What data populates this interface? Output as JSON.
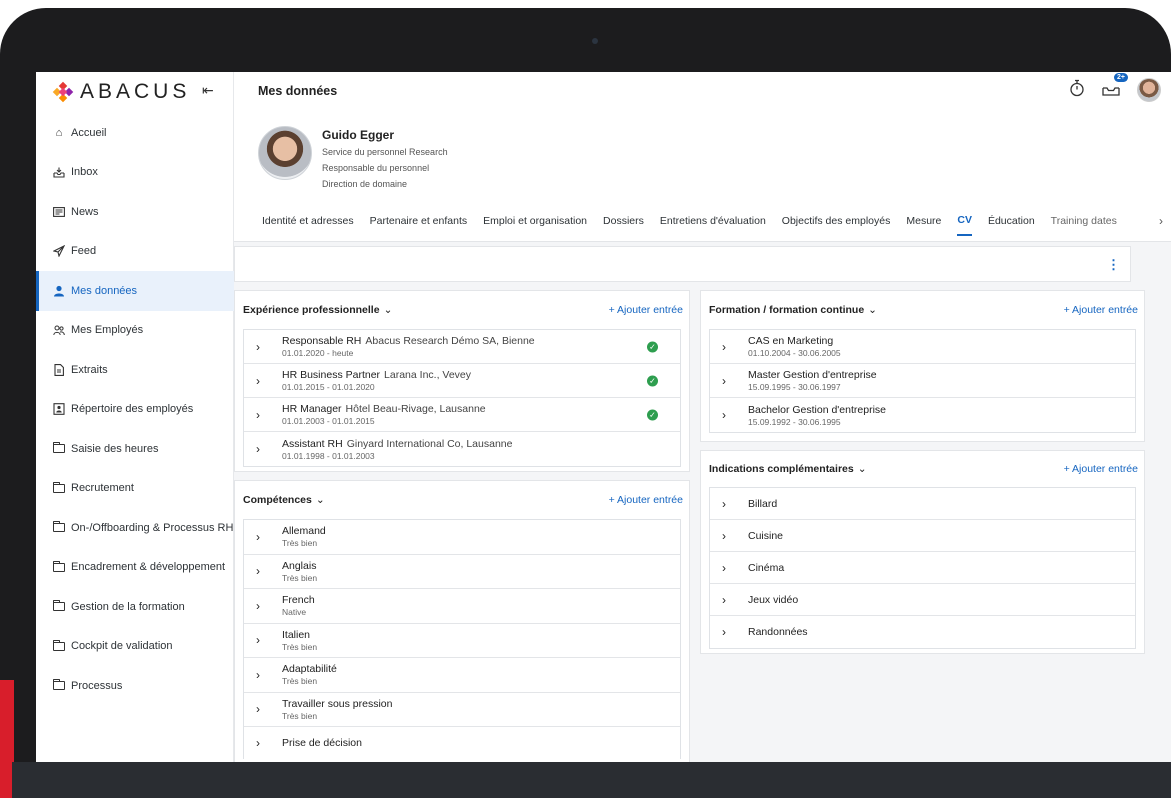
{
  "app": {
    "logo_text": "ABACUS",
    "logo_icon": "abacus-diamond-logo",
    "accent": "#1565c0"
  },
  "sidebar": {
    "collapse_icon": "collapse-left-icon",
    "items": [
      {
        "label": "Accueil",
        "icon": "home-icon"
      },
      {
        "label": "Inbox",
        "icon": "inbox-icon"
      },
      {
        "label": "News",
        "icon": "news-icon"
      },
      {
        "label": "Feed",
        "icon": "feed-icon"
      },
      {
        "label": "Mes données",
        "icon": "person-icon",
        "active": true
      },
      {
        "label": "Mes Employés",
        "icon": "people-icon"
      },
      {
        "label": "Extraits",
        "icon": "document-icon"
      },
      {
        "label": "Répertoire des employés",
        "icon": "directory-icon"
      },
      {
        "label": "Saisie des heures",
        "icon": "folder-icon"
      },
      {
        "label": "Recrutement",
        "icon": "folder-icon"
      },
      {
        "label": "On-/Offboarding & Processus RH",
        "icon": "folder-icon"
      },
      {
        "label": "Encadrement & développement",
        "icon": "folder-icon"
      },
      {
        "label": "Gestion de la formation",
        "icon": "folder-icon"
      },
      {
        "label": "Cockpit de validation",
        "icon": "folder-icon"
      },
      {
        "label": "Processus",
        "icon": "folder-icon"
      }
    ]
  },
  "header": {
    "title": "Mes données",
    "notification_badge": "2+"
  },
  "profile": {
    "name": "Guido Egger",
    "line1": "Service du personnel Research",
    "line2": "Responsable du personnel",
    "line3": "Direction de domaine"
  },
  "tabs": [
    {
      "label": "Identité et adresses"
    },
    {
      "label": "Partenaire et enfants"
    },
    {
      "label": "Emploi et organisation"
    },
    {
      "label": "Dossiers"
    },
    {
      "label": "Entretiens d'évaluation"
    },
    {
      "label": "Objectifs des employés"
    },
    {
      "label": "Mesure"
    },
    {
      "label": "CV",
      "active": true
    },
    {
      "label": "Éducation"
    },
    {
      "label": "Training dates"
    }
  ],
  "add_label": "+ Ajouter entrée",
  "experience": {
    "title": "Expérience professionnelle",
    "rows": [
      {
        "role": "Responsable RH",
        "company": "Abacus Research Démo SA, Bienne",
        "dates": "01.01.2020 - heute",
        "verified": true
      },
      {
        "role": "HR Business Partner",
        "company": "Larana Inc., Vevey",
        "dates": "01.01.2015 - 01.01.2020",
        "verified": true
      },
      {
        "role": "HR Manager",
        "company": "Hôtel Beau-Rivage, Lausanne",
        "dates": "01.01.2003 - 01.01.2015",
        "verified": true
      },
      {
        "role": "Assistant RH",
        "company": "Ginyard International Co, Lausanne",
        "dates": "01.01.1998 - 01.01.2003",
        "verified": false
      }
    ]
  },
  "skills": {
    "title": "Compétences",
    "rows": [
      {
        "name": "Allemand",
        "level": "Très bien"
      },
      {
        "name": "Anglais",
        "level": "Très bien"
      },
      {
        "name": "French",
        "level": "Native"
      },
      {
        "name": "Italien",
        "level": "Très bien"
      },
      {
        "name": "Adaptabilité",
        "level": "Très bien"
      },
      {
        "name": "Travailler sous pression",
        "level": "Très bien"
      },
      {
        "name": "Prise de décision",
        "level": ""
      }
    ]
  },
  "education": {
    "title": "Formation / formation continue",
    "rows": [
      {
        "name": "CAS en Marketing",
        "dates": "01.10.2004 - 30.06.2005"
      },
      {
        "name": "Master Gestion d'entreprise",
        "dates": "15.09.1995 - 30.06.1997"
      },
      {
        "name": "Bachelor Gestion d'entreprise",
        "dates": "15.09.1992 - 30.06.1995"
      }
    ]
  },
  "additional": {
    "title": "Indications complémentaires",
    "rows": [
      {
        "name": "Billard"
      },
      {
        "name": "Cuisine"
      },
      {
        "name": "Cinéma"
      },
      {
        "name": "Jeux vidéo"
      },
      {
        "name": "Randonnées"
      }
    ]
  }
}
